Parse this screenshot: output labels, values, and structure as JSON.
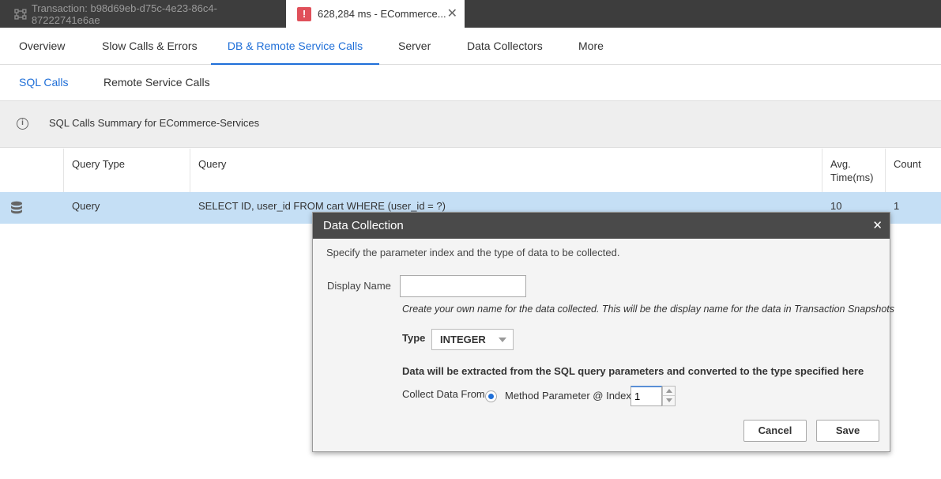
{
  "window_tabs": [
    {
      "title": "Transaction: b98d69eb-d75c-4e23-86c4-87222741e6ae",
      "icon": "transaction-icon"
    },
    {
      "title": "628,284 ms - ECommerce...",
      "icon": "alert-icon",
      "close": "✕"
    }
  ],
  "nav": {
    "items": [
      "Overview",
      "Slow Calls & Errors",
      "DB & Remote Service Calls",
      "Server",
      "Data Collectors",
      "More"
    ],
    "active": "DB & Remote Service Calls"
  },
  "subnav": {
    "items": [
      "SQL Calls",
      "Remote Service Calls"
    ],
    "active": "SQL Calls"
  },
  "summary": {
    "text": "SQL Calls Summary for ECommerce-Services",
    "icon": "info-icon"
  },
  "table": {
    "headers": [
      "Query Type",
      "Query",
      "Avg. Time(ms)",
      "Count"
    ],
    "rows": [
      {
        "icon": "database-icon",
        "query_type": "Query",
        "query": "SELECT ID, user_id FROM cart WHERE (user_id = ?)",
        "avg_time": "10",
        "count": "1"
      }
    ]
  },
  "modal": {
    "title": "Data Collection",
    "close": "✕",
    "description": "Specify the parameter index and the type of data to be collected.",
    "display_name_label": "Display Name",
    "display_name_value": "",
    "display_name_hint": "Create your own name for the data collected.  This will be the display name for the data in Transaction Snapshots",
    "type_label": "Type",
    "type_value": "INTEGER",
    "extract_note": "Data will be extracted from the SQL query parameters and converted to the type specified here",
    "collect_from_label": "Collect Data From",
    "method_param_label": "Method Parameter @ Index:",
    "index_value": "1",
    "cancel_label": "Cancel",
    "save_label": "Save"
  },
  "colors": {
    "accent": "#1f6fd8",
    "selected_row": "#c5dff5",
    "topbar": "#3d3d3d",
    "modal_header": "#4a4a4a",
    "alert": "#e0505a"
  }
}
